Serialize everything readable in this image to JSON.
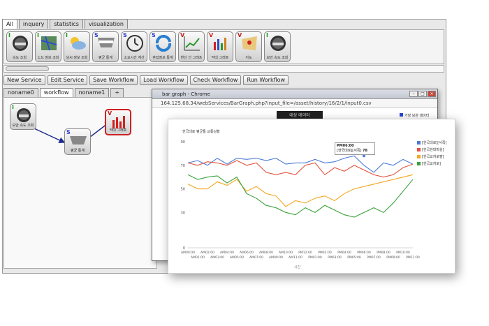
{
  "main_tabs": [
    "All",
    "inquery",
    "statistics",
    "visualization"
  ],
  "palette": [
    {
      "badge": "I",
      "icon": "speedometer-icon",
      "label": "속도 조회",
      "type": "i"
    },
    {
      "badge": "I",
      "icon": "map-icon",
      "label": "노드 정보 조회",
      "type": "i"
    },
    {
      "badge": "I",
      "icon": "weather-icon",
      "label": "날씨 정보 조회",
      "type": "i"
    },
    {
      "badge": "S",
      "icon": "average-icon",
      "label": "평균 통계",
      "type": "s"
    },
    {
      "badge": "S",
      "icon": "clock-icon",
      "label": "소요시간 계산",
      "type": "s"
    },
    {
      "badge": "S",
      "icon": "refresh-icon",
      "label": "혼잡정보 통계",
      "type": "s"
    },
    {
      "badge": "V",
      "icon": "line-chart-icon",
      "label": "환산 선 그래프",
      "type": "v"
    },
    {
      "badge": "V",
      "icon": "bar-chart-icon",
      "label": "막대 그래프",
      "type": "v"
    },
    {
      "badge": "V",
      "icon": "map-pin-icon",
      "label": "지도",
      "type": "v"
    },
    {
      "badge": "I",
      "icon": "speedometer-icon",
      "label": "보안 속도 조회",
      "type": "i"
    }
  ],
  "toolbar": [
    "New Service",
    "Edit Service",
    "Save Workflow",
    "Load Workflow",
    "Check Workflow",
    "Run Workflow"
  ],
  "workflow_tabs": [
    "noname0",
    "workflow",
    "noname1",
    "+"
  ],
  "nodes": [
    {
      "label": "보안 속도 조회",
      "badge": "I"
    },
    {
      "label": "평균 통계",
      "badge": "S"
    },
    {
      "label": "막대 그래프",
      "badge": "V"
    }
  ],
  "browser": {
    "title": "bar graph - Chrome",
    "url": "164.125.68.34/webServices/BarGraph.php?input_file=/asset/history/16/2/1/input0.csv",
    "dark_label": "대상 데이터",
    "marker": "가장 보완 데이터"
  },
  "chart_data": {
    "type": "line",
    "title": "한국대로 평균통 교통상황",
    "x": [
      "AM00:00",
      "AM01:00",
      "AM02:00",
      "AM03:00",
      "AM04:00",
      "AM05:00",
      "AM06:00",
      "AM07:00",
      "AM08:00",
      "AM09:00",
      "AM10:00",
      "AM11:00",
      "PM12:00",
      "PM01:00",
      "PM02:00",
      "PM03:00",
      "PM04:00",
      "PM05:00",
      "PM06:00",
      "PM07:00",
      "PM08:00",
      "PM09:00",
      "PM10:00",
      "PM11:00"
    ],
    "xlabel": "시간",
    "ylim": [
      0,
      90
    ],
    "yticks": [
      0,
      30,
      50,
      70,
      90
    ],
    "series": [
      {
        "name": "[한국대로][서쪽]",
        "color": "#4a7bd6",
        "values": [
          72,
          74,
          70,
          76,
          71,
          76,
          75,
          76,
          74,
          76,
          71,
          72,
          72,
          75,
          72,
          73,
          76,
          78,
          70,
          64,
          72,
          70,
          75,
          71
        ]
      },
      {
        "name": "[한국현대마을]",
        "color": "#e0533d",
        "values": [
          72,
          70,
          73,
          72,
          70,
          74,
          70,
          72,
          64,
          62,
          64,
          62,
          70,
          72,
          62,
          68,
          65,
          70,
          66,
          62,
          60,
          62,
          68,
          71
        ]
      },
      {
        "name": "[한국교차로팔]",
        "color": "#f5a623",
        "values": [
          54,
          50,
          50,
          56,
          53,
          58,
          48,
          52,
          46,
          44,
          35,
          40,
          38,
          42,
          44,
          40,
          46,
          50,
          52,
          54,
          56,
          58,
          60,
          62
        ]
      },
      {
        "name": "[한국교차로]",
        "color": "#3aa23a",
        "values": [
          62,
          58,
          60,
          61,
          55,
          60,
          46,
          42,
          36,
          34,
          30,
          28,
          34,
          30,
          36,
          32,
          28,
          26,
          30,
          34,
          30,
          38,
          48,
          58
        ]
      }
    ],
    "tooltip": {
      "time": "PM06:00",
      "series": "[한국대로][서쪽]",
      "value": "78"
    },
    "legend_position": "right",
    "grid": false
  }
}
